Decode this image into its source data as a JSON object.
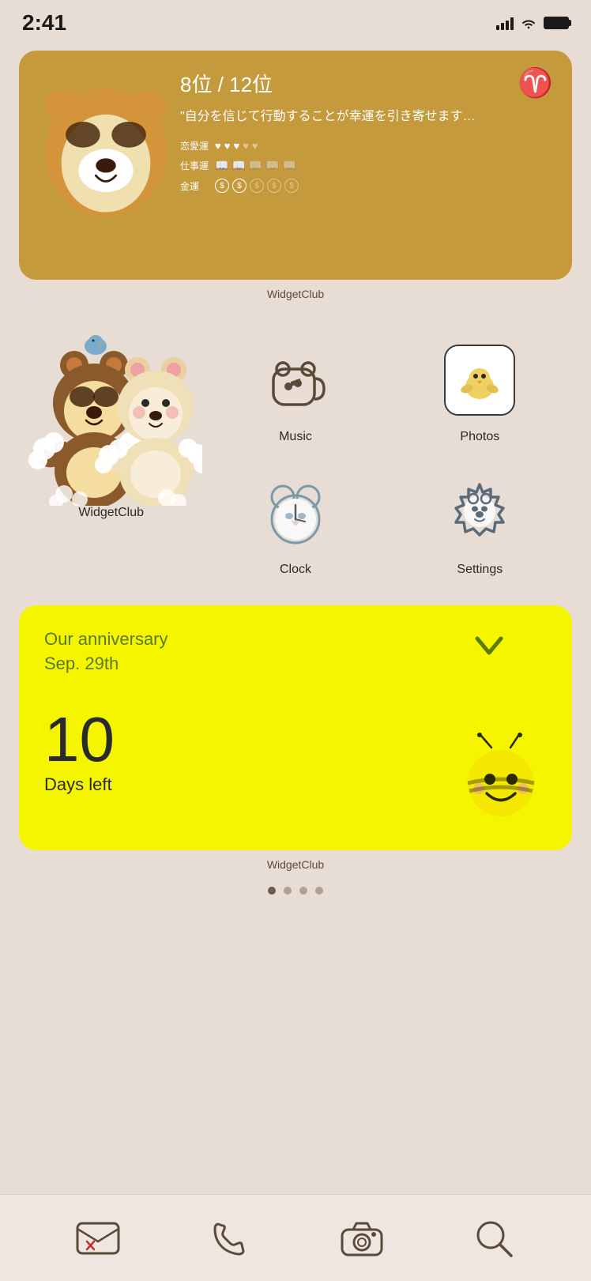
{
  "statusBar": {
    "time": "2:41",
    "battery": "full"
  },
  "horoscopeWidget": {
    "rank": "8位 / 12位",
    "sign": "♈",
    "quote": "\"自分を信じて行動することが幸運を引き寄せます…",
    "rows": [
      {
        "label": "恋愛運",
        "filled": 3,
        "total": 5
      },
      {
        "label": "仕事運",
        "filled": 2,
        "total": 5
      },
      {
        "label": "金運",
        "filled": 2,
        "total": 5
      }
    ],
    "widgetClubLabel": "WidgetClub"
  },
  "appGrid": {
    "apps": [
      {
        "name": "Music",
        "icon": "music"
      },
      {
        "name": "Photos",
        "icon": "photos"
      },
      {
        "name": "",
        "icon": "mascot"
      },
      {
        "name": "Clock",
        "icon": "clock"
      },
      {
        "name": "Settings",
        "icon": "settings"
      },
      {
        "name": "WidgetClub",
        "icon": "widgetclub-label"
      }
    ]
  },
  "anniversaryWidget": {
    "title": "Our anniversary\nSep. 29th",
    "days": "10",
    "daysLabel": "Days left",
    "widgetClubLabel": "WidgetClub"
  },
  "pageDots": {
    "total": 4,
    "active": 0
  },
  "dock": {
    "items": [
      "mail",
      "phone",
      "camera",
      "search"
    ]
  },
  "widgetClubLabel1": "WidgetClub",
  "widgetClubLabel2": "WidgetClub"
}
